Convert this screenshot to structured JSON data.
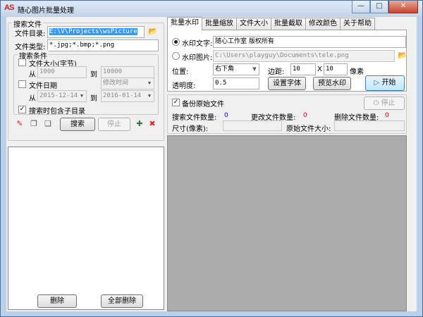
{
  "window": {
    "title": "随心图片批量处理",
    "app_icon_text": "AS",
    "min": "—",
    "max": "□",
    "close": "✕"
  },
  "search": {
    "group_title": "搜索文件",
    "dir_label": "文件目录:",
    "dir_value": "E:\\V\\Projects\\wsPicture",
    "type_label": "文件类型:",
    "type_value": "*.jpg;*.bmp;*.png",
    "conditions_title": "搜索条件",
    "size_label": "文件大小(字节)",
    "from": "从",
    "to": "到",
    "size_from": "1000",
    "size_to": "10000",
    "date_label": "文件日期",
    "date_mode": "修改时间",
    "date_from": "2015-12-14",
    "date_to": "2016-01-14",
    "include_sub": "搜索时包含子目录",
    "search_btn": "搜索",
    "stop_btn": "停止",
    "delete_btn": "删除",
    "delete_all_btn": "全部删除"
  },
  "tabs": [
    "批量水印",
    "批量缩放",
    "文件大小",
    "批量截取",
    "修改颜色",
    "关于帮助"
  ],
  "watermark": {
    "text_label": "水印文字:",
    "text_value": "随心工作室  版权所有",
    "image_label": "水印图片:",
    "image_value": "C:\\Users\\playguy\\Documents\\tele.png",
    "position_label": "位置:",
    "position_value": "右下角",
    "margin_label": "边距:",
    "margin_x": "10",
    "x_sep": "X",
    "margin_y": "10",
    "pixel_label": "像素",
    "opacity_label": "透明度:",
    "opacity_value": "0.5",
    "font_btn": "设置字体",
    "preview_btn": "预览水印",
    "start_btn": "开始"
  },
  "status": {
    "backup_label": "备份原始文件",
    "stop_btn": "停止",
    "found_label": "搜索文件数量:",
    "found_value": "0",
    "changed_label": "更改文件数量:",
    "changed_value": "0",
    "deleted_label": "删除文件数量:",
    "deleted_value": "0",
    "size_label": "尺寸(像素):",
    "orig_size_label": "原始文件大小:"
  },
  "colors": {
    "title_bg": "#c3d5ea",
    "selection": "#3399ff",
    "count_blue": "#0000ff",
    "count_red": "#e00000"
  }
}
